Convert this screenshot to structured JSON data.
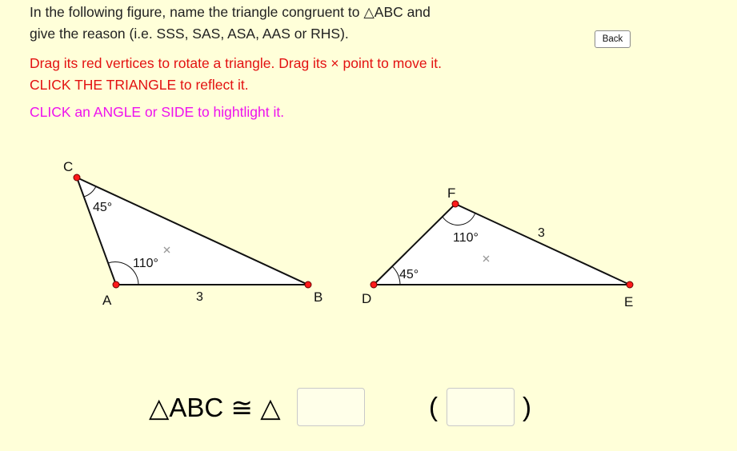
{
  "instructions": {
    "line1": "In the following figure, name the triangle congruent to △ABC and",
    "line2": "give the reason (i.e. SSS, SAS, ASA, AAS or RHS).",
    "drag": "Drag its red vertices to rotate a triangle. Drag its × point to move it.",
    "reflect": "CLICK THE TRIANGLE to reflect it.",
    "highlight": "CLICK an ANGLE or SIDE to hightlight it."
  },
  "back_label": "Back",
  "triangle_abc": {
    "vertices": {
      "A": "A",
      "B": "B",
      "C": "C"
    },
    "angle_C": "45°",
    "angle_A": "110°",
    "side_AB": "3"
  },
  "triangle_def": {
    "vertices": {
      "D": "D",
      "E": "E",
      "F": "F"
    },
    "angle_D": "45°",
    "angle_F": "110°",
    "side_FE": "3"
  },
  "move_point_symbol": "×",
  "answer": {
    "congruence_text": "△ABC ≅ △",
    "triangle_value": "",
    "open_paren": "(",
    "reason_value": "",
    "close_paren": ")"
  },
  "colors": {
    "background": "#ffffd9",
    "instruction_red": "#e31111",
    "instruction_magenta": "#ee11ee",
    "vertex_point": "#ff1a1a"
  }
}
